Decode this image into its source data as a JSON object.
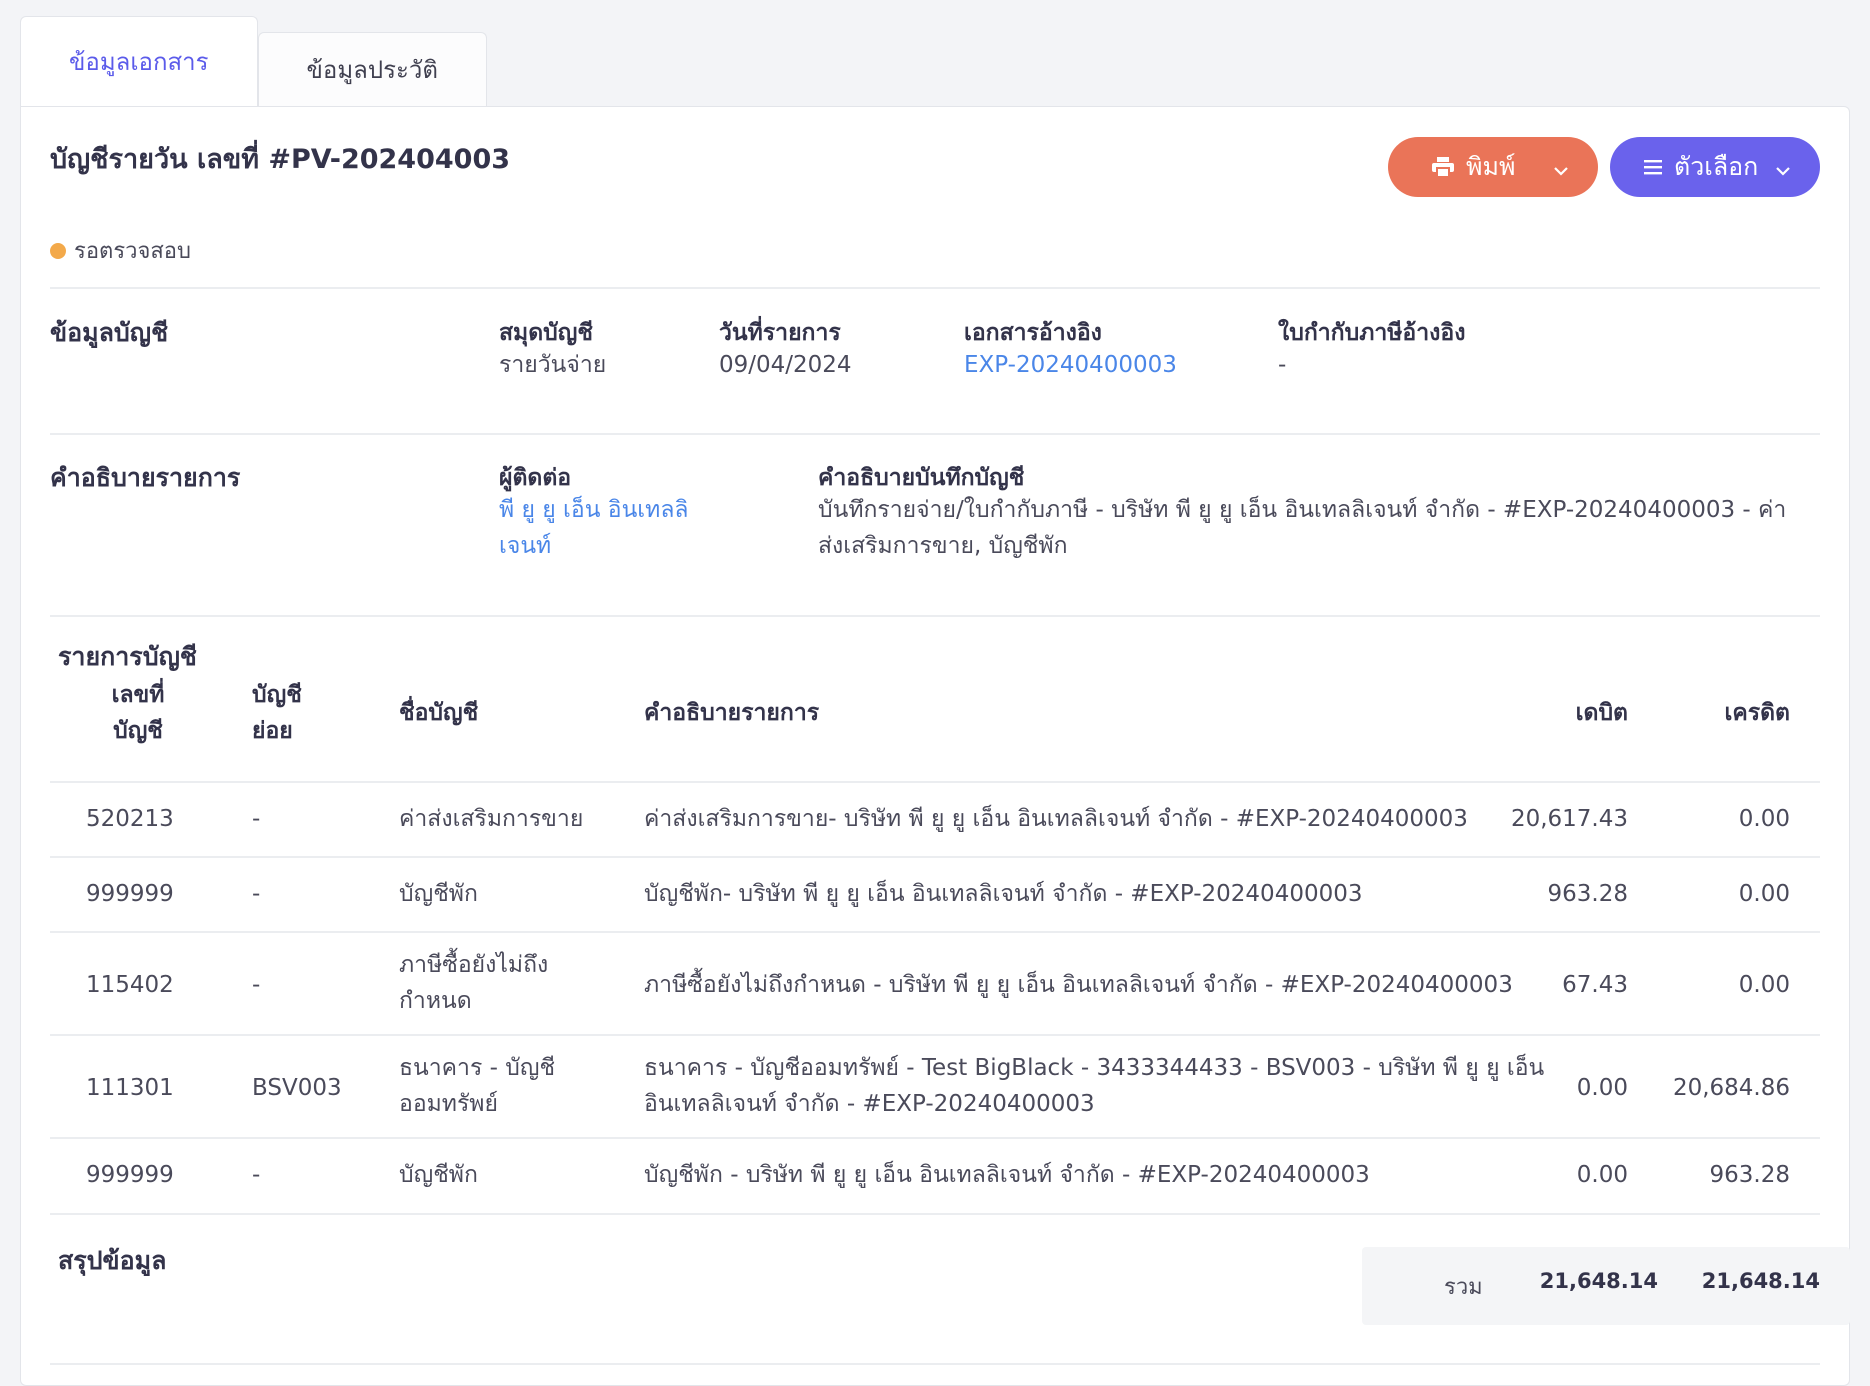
{
  "tabs": [
    {
      "label": "ข้อมูลเอกสาร"
    },
    {
      "label": "ข้อมูลประวัติ"
    }
  ],
  "header": {
    "title": "บัญชีรายวัน เลขที่ #PV-202404003",
    "print_label": "พิมพ์",
    "options_label": "ตัวเลือก",
    "status": "รอตรวจสอบ",
    "status_color": "#f3a94a"
  },
  "account_info": {
    "section_label": "ข้อมูลบัญชี",
    "book_label": "สมุดบัญชี",
    "book_value": "รายวันจ่าย",
    "date_label": "วันที่รายการ",
    "date_value": "09/04/2024",
    "ref_doc_label": "เอกสารอ้างอิง",
    "ref_doc_value": "EXP-20240400003",
    "tax_ref_label": "ใบกำกับภาษีอ้างอิง",
    "tax_ref_value": "-"
  },
  "description": {
    "section_label": "คำอธิบายรายการ",
    "contact_label": "ผู้ติดต่อ",
    "contact_line1": "พี ยู ยู เอ็น อินเทลลิ",
    "contact_line2": "เจนท์",
    "memo_label": "คำอธิบายบันทึกบัญชี",
    "memo_line1": "บันทึกรายจ่าย/ใบกำกับภาษี - บริษัท พี ยู ยู เอ็น อินเทลลิเจนท์ จำกัด - #EXP-20240400003 - ค่า",
    "memo_line2": "ส่งเสริมการขาย, บัญชีพัก"
  },
  "entries": {
    "title": "รายการบัญชี",
    "headers": {
      "acc_no_1": "เลขที่",
      "acc_no_2": "บัญชี",
      "sub_1": "บัญชี",
      "sub_2": "ย่อย",
      "name": "ชื่อบัญชี",
      "desc": "คำอธิบายรายการ",
      "debit": "เดบิต",
      "credit": "เครดิต"
    },
    "rows": [
      {
        "no": "520213",
        "sub": "-",
        "name1": "ค่าส่งเสริมการขาย",
        "name2": "",
        "desc1": "ค่าส่งเสริมการขาย- บริษัท พี ยู ยู เอ็น อินเทลลิเจนท์ จำกัด - #EXP-20240400003",
        "desc2": "",
        "debit": "20,617.43",
        "credit": "0.00"
      },
      {
        "no": "999999",
        "sub": "-",
        "name1": "บัญชีพัก",
        "name2": "",
        "desc1": "บัญชีพัก- บริษัท พี ยู ยู เอ็น อินเทลลิเจนท์ จำกัด - #EXP-20240400003",
        "desc2": "",
        "debit": "963.28",
        "credit": "0.00"
      },
      {
        "no": "115402",
        "sub": "-",
        "name1": "ภาษีซื้อยังไม่ถึง",
        "name2": "กำหนด",
        "desc1": "ภาษีซื้อยังไม่ถึงกำหนด - บริษัท พี ยู ยู เอ็น อินเทลลิเจนท์ จำกัด - #EXP-20240400003",
        "desc2": "",
        "debit": "67.43",
        "credit": "0.00"
      },
      {
        "no": "111301",
        "sub": "BSV003",
        "name1": "ธนาคาร - บัญชี",
        "name2": "ออมทรัพย์",
        "desc1": "ธนาคาร - บัญชีออมทรัพย์ - Test BigBlack - 3433344433 - BSV003 - บริษัท พี ยู ยู เอ็น",
        "desc2": "อินเทลลิเจนท์ จำกัด - #EXP-20240400003",
        "debit": "0.00",
        "credit": "20,684.86"
      },
      {
        "no": "999999",
        "sub": "-",
        "name1": "บัญชีพัก",
        "name2": "",
        "desc1": "บัญชีพัก - บริษัท พี ยู ยู เอ็น อินเทลลิเจนท์ จำกัด - #EXP-20240400003",
        "desc2": "",
        "debit": "0.00",
        "credit": "963.28"
      }
    ]
  },
  "summary": {
    "title": "สรุปข้อมูล",
    "total_label": "รวม",
    "total_debit": "21,648.14",
    "total_credit": "21,648.14"
  }
}
